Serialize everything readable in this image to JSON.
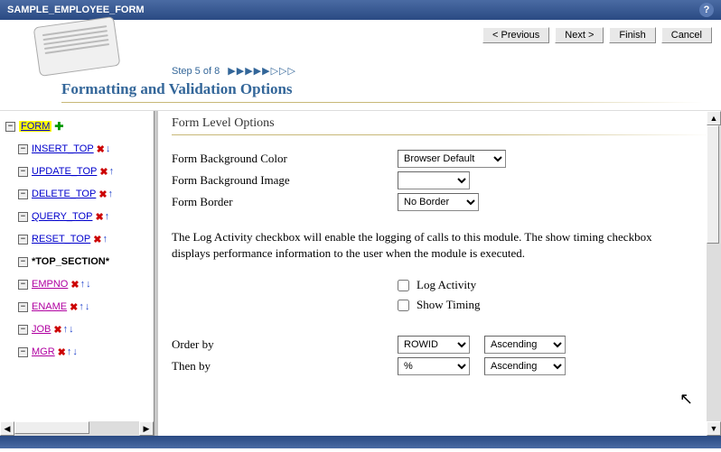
{
  "title_bar": {
    "title": "SAMPLE_EMPLOYEE_FORM"
  },
  "wizard": {
    "prev": "< Previous",
    "next": "Next >",
    "finish": "Finish",
    "cancel": "Cancel",
    "step_text": "Step 5 of 8",
    "page_title": "Formatting and Validation Options"
  },
  "tree": {
    "root": "FORM",
    "items": [
      {
        "label": "INSERT_TOP",
        "icons": [
          "del",
          "dn"
        ]
      },
      {
        "label": "UPDATE_TOP",
        "icons": [
          "del",
          "up",
          "dn_part"
        ]
      },
      {
        "label": "DELETE_TOP",
        "icons": [
          "del",
          "up",
          "dn_part"
        ]
      },
      {
        "label": "QUERY_TOP",
        "icons": [
          "del",
          "up"
        ]
      },
      {
        "label": "RESET_TOP",
        "icons": [
          "del",
          "up"
        ]
      }
    ],
    "section": "*TOP_SECTION*",
    "fields": [
      {
        "label": "EMPNO",
        "icons": [
          "del",
          "up",
          "dn"
        ]
      },
      {
        "label": "ENAME",
        "icons": [
          "del",
          "up",
          "dn"
        ]
      },
      {
        "label": "JOB",
        "icons": [
          "del",
          "up",
          "dn"
        ]
      },
      {
        "label": "MGR",
        "icons": [
          "del",
          "up",
          "dn"
        ]
      }
    ]
  },
  "form_options": {
    "section_title": "Form Level Options",
    "bg_color_label": "Form Background Color",
    "bg_color_value": "Browser Default",
    "bg_image_label": "Form Background Image",
    "bg_image_value": "",
    "border_label": "Form Border",
    "border_value": "No Border",
    "info_text": "The Log Activity checkbox will enable the logging of calls to this module. The show timing checkbox displays performance information to the user when the module is executed.",
    "log_activity_label": "Log Activity",
    "show_timing_label": "Show Timing",
    "order_by_label": "Order by",
    "order_by_col": "ROWID",
    "order_by_dir": "Ascending",
    "then_by_label": "Then by",
    "then_by_col": "%",
    "then_by_dir": "Ascending"
  }
}
